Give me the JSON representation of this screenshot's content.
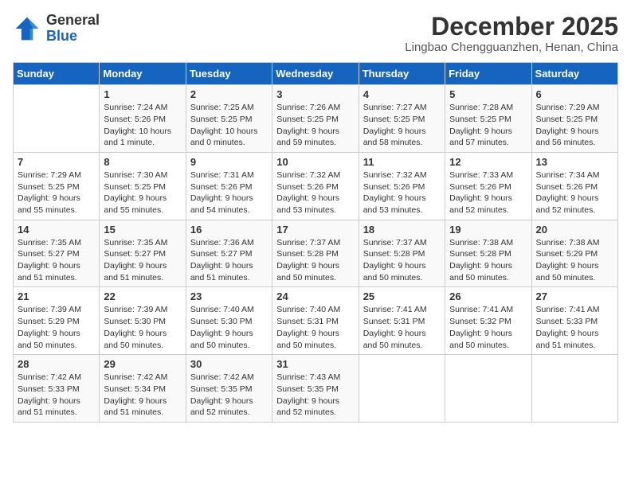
{
  "header": {
    "logo_general": "General",
    "logo_blue": "Blue",
    "month_title": "December 2025",
    "subtitle": "Lingbao Chengguanzhen, Henan, China"
  },
  "weekdays": [
    "Sunday",
    "Monday",
    "Tuesday",
    "Wednesday",
    "Thursday",
    "Friday",
    "Saturday"
  ],
  "weeks": [
    [
      {
        "day": "",
        "info": ""
      },
      {
        "day": "1",
        "info": "Sunrise: 7:24 AM\nSunset: 5:26 PM\nDaylight: 10 hours\nand 1 minute."
      },
      {
        "day": "2",
        "info": "Sunrise: 7:25 AM\nSunset: 5:25 PM\nDaylight: 10 hours\nand 0 minutes."
      },
      {
        "day": "3",
        "info": "Sunrise: 7:26 AM\nSunset: 5:25 PM\nDaylight: 9 hours\nand 59 minutes."
      },
      {
        "day": "4",
        "info": "Sunrise: 7:27 AM\nSunset: 5:25 PM\nDaylight: 9 hours\nand 58 minutes."
      },
      {
        "day": "5",
        "info": "Sunrise: 7:28 AM\nSunset: 5:25 PM\nDaylight: 9 hours\nand 57 minutes."
      },
      {
        "day": "6",
        "info": "Sunrise: 7:29 AM\nSunset: 5:25 PM\nDaylight: 9 hours\nand 56 minutes."
      }
    ],
    [
      {
        "day": "7",
        "info": "Sunrise: 7:29 AM\nSunset: 5:25 PM\nDaylight: 9 hours\nand 55 minutes."
      },
      {
        "day": "8",
        "info": "Sunrise: 7:30 AM\nSunset: 5:25 PM\nDaylight: 9 hours\nand 55 minutes."
      },
      {
        "day": "9",
        "info": "Sunrise: 7:31 AM\nSunset: 5:26 PM\nDaylight: 9 hours\nand 54 minutes."
      },
      {
        "day": "10",
        "info": "Sunrise: 7:32 AM\nSunset: 5:26 PM\nDaylight: 9 hours\nand 53 minutes."
      },
      {
        "day": "11",
        "info": "Sunrise: 7:32 AM\nSunset: 5:26 PM\nDaylight: 9 hours\nand 53 minutes."
      },
      {
        "day": "12",
        "info": "Sunrise: 7:33 AM\nSunset: 5:26 PM\nDaylight: 9 hours\nand 52 minutes."
      },
      {
        "day": "13",
        "info": "Sunrise: 7:34 AM\nSunset: 5:26 PM\nDaylight: 9 hours\nand 52 minutes."
      }
    ],
    [
      {
        "day": "14",
        "info": "Sunrise: 7:35 AM\nSunset: 5:27 PM\nDaylight: 9 hours\nand 51 minutes."
      },
      {
        "day": "15",
        "info": "Sunrise: 7:35 AM\nSunset: 5:27 PM\nDaylight: 9 hours\nand 51 minutes."
      },
      {
        "day": "16",
        "info": "Sunrise: 7:36 AM\nSunset: 5:27 PM\nDaylight: 9 hours\nand 51 minutes."
      },
      {
        "day": "17",
        "info": "Sunrise: 7:37 AM\nSunset: 5:28 PM\nDaylight: 9 hours\nand 50 minutes."
      },
      {
        "day": "18",
        "info": "Sunrise: 7:37 AM\nSunset: 5:28 PM\nDaylight: 9 hours\nand 50 minutes."
      },
      {
        "day": "19",
        "info": "Sunrise: 7:38 AM\nSunset: 5:28 PM\nDaylight: 9 hours\nand 50 minutes."
      },
      {
        "day": "20",
        "info": "Sunrise: 7:38 AM\nSunset: 5:29 PM\nDaylight: 9 hours\nand 50 minutes."
      }
    ],
    [
      {
        "day": "21",
        "info": "Sunrise: 7:39 AM\nSunset: 5:29 PM\nDaylight: 9 hours\nand 50 minutes."
      },
      {
        "day": "22",
        "info": "Sunrise: 7:39 AM\nSunset: 5:30 PM\nDaylight: 9 hours\nand 50 minutes."
      },
      {
        "day": "23",
        "info": "Sunrise: 7:40 AM\nSunset: 5:30 PM\nDaylight: 9 hours\nand 50 minutes."
      },
      {
        "day": "24",
        "info": "Sunrise: 7:40 AM\nSunset: 5:31 PM\nDaylight: 9 hours\nand 50 minutes."
      },
      {
        "day": "25",
        "info": "Sunrise: 7:41 AM\nSunset: 5:31 PM\nDaylight: 9 hours\nand 50 minutes."
      },
      {
        "day": "26",
        "info": "Sunrise: 7:41 AM\nSunset: 5:32 PM\nDaylight: 9 hours\nand 50 minutes."
      },
      {
        "day": "27",
        "info": "Sunrise: 7:41 AM\nSunset: 5:33 PM\nDaylight: 9 hours\nand 51 minutes."
      }
    ],
    [
      {
        "day": "28",
        "info": "Sunrise: 7:42 AM\nSunset: 5:33 PM\nDaylight: 9 hours\nand 51 minutes."
      },
      {
        "day": "29",
        "info": "Sunrise: 7:42 AM\nSunset: 5:34 PM\nDaylight: 9 hours\nand 51 minutes."
      },
      {
        "day": "30",
        "info": "Sunrise: 7:42 AM\nSunset: 5:35 PM\nDaylight: 9 hours\nand 52 minutes."
      },
      {
        "day": "31",
        "info": "Sunrise: 7:43 AM\nSunset: 5:35 PM\nDaylight: 9 hours\nand 52 minutes."
      },
      {
        "day": "",
        "info": ""
      },
      {
        "day": "",
        "info": ""
      },
      {
        "day": "",
        "info": ""
      }
    ]
  ]
}
